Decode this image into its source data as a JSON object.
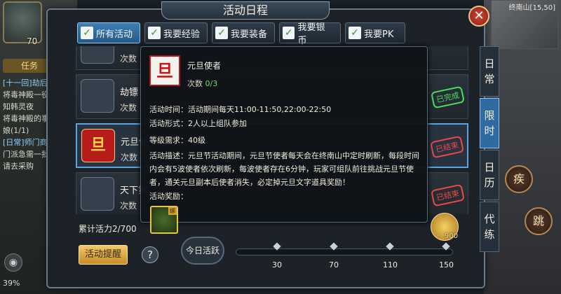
{
  "background": {
    "player_level": "70",
    "task_tab": "任务",
    "task_lines": [
      "[十一回]劫后余生",
      "将毒神殿一役的",
      "知韩灵夜",
      "将毒神殿的事告",
      "娘(1/1)",
      "[日常]师门商环",
      "门派急需一批百",
      "请去采购"
    ],
    "battery": "39%",
    "map_label": "终南山[15,50]",
    "skill_glyphs": [
      "疾",
      "跳"
    ]
  },
  "window": {
    "title": "活动日程",
    "close_glyph": "✕"
  },
  "tabs": [
    {
      "label": "所有活动",
      "active": true
    },
    {
      "label": "我要经验",
      "active": false
    },
    {
      "label": "我要装备",
      "active": false
    },
    {
      "label": "我要银币",
      "active": false
    },
    {
      "label": "我要PK",
      "active": false
    }
  ],
  "list": [
    {
      "name": "",
      "count_label": "次数",
      "stamp": "",
      "icon": "gem-bundle"
    },
    {
      "name": "劫镖",
      "count_label": "次数",
      "stamp": "已完成",
      "stamp_type": "done",
      "icon": "silver-ingots"
    },
    {
      "name": "元旦使",
      "count_label": "次数",
      "stamp": "已结束",
      "stamp_type": "ended",
      "icon": "dan-character"
    },
    {
      "name": "天下第",
      "count_label": "次数",
      "stamp": "已结束",
      "stamp_type": "ended",
      "icon": "jade-bundle"
    }
  ],
  "side_tabs": [
    {
      "label": "日常",
      "active": false
    },
    {
      "label": "限时",
      "active": true
    },
    {
      "label": "日历",
      "active": false
    },
    {
      "label": "代练",
      "active": false
    }
  ],
  "bottom": {
    "vitality": "累计活力2/700",
    "remind_button": "活动提醒",
    "help": "?",
    "today_button": "今日活跃",
    "progress_fraction": 0.0,
    "ticks": [
      "30",
      "70",
      "110",
      "150"
    ],
    "reward_value": "900"
  },
  "popup": {
    "icon_glyph": "旦",
    "name": "元旦使者",
    "count_label": "次数",
    "count_value": "0/3",
    "time": "活动时间：活动期间每天11:00-11:50,22:00-22:50",
    "form": "活动形式：2人以上组队参加",
    "level": "等级需求：40级",
    "desc": "活动描述：元旦节活动期间，元旦节使者每天会在终南山中定时刷新，每段时间内会有5波使者依次刷新，每波使者存在6分钟，玩家可组队前往挑战元旦节使者，通关元旦副本后使者消失，必定掉元旦文字道具奖励！",
    "reward_label": "活动奖励：",
    "reward_bind": "绑"
  },
  "colors": {
    "accent_blue": "#2f6aa0",
    "done_green": "#4ce05a",
    "ended_red": "#f04848",
    "gold": "#e8c24a"
  }
}
